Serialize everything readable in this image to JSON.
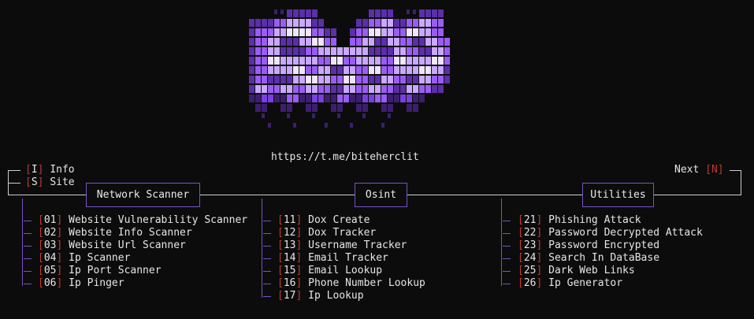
{
  "url": "https://t.me/biteherclit",
  "colors": {
    "accent": "#7a52c7",
    "bracket": "#c0392b",
    "text": "#e6e6e6",
    "background": "#0c0c0c"
  },
  "left_options": [
    {
      "key": "I",
      "label": "Info"
    },
    {
      "key": "S",
      "label": "Site"
    }
  ],
  "next": {
    "label": "Next",
    "key": "N"
  },
  "sections": [
    {
      "title": "Network Scanner",
      "items": [
        {
          "num": "01",
          "label": "Website Vulnerability Scanner"
        },
        {
          "num": "02",
          "label": "Website Info Scanner"
        },
        {
          "num": "03",
          "label": "Website Url Scanner"
        },
        {
          "num": "04",
          "label": "Ip Scanner"
        },
        {
          "num": "05",
          "label": "Ip Port Scanner"
        },
        {
          "num": "06",
          "label": "Ip Pinger"
        }
      ]
    },
    {
      "title": "Osint",
      "items": [
        {
          "num": "11",
          "label": "Dox Create"
        },
        {
          "num": "12",
          "label": "Dox Tracker"
        },
        {
          "num": "13",
          "label": "Username Tracker"
        },
        {
          "num": "14",
          "label": "Email Tracker"
        },
        {
          "num": "15",
          "label": "Email Lookup"
        },
        {
          "num": "16",
          "label": "Phone Number Lookup"
        },
        {
          "num": "17",
          "label": "Ip Lookup"
        }
      ]
    },
    {
      "title": "Utilities",
      "items": [
        {
          "num": "21",
          "label": "Phishing Attack"
        },
        {
          "num": "22",
          "label": "Password Decrypted Attack"
        },
        {
          "num": "23",
          "label": "Password Encrypted"
        },
        {
          "num": "24",
          "label": "Search In DataBase"
        },
        {
          "num": "25",
          "label": "Dark Web Links"
        },
        {
          "num": "26",
          "label": "Ip Generator"
        }
      ]
    }
  ]
}
